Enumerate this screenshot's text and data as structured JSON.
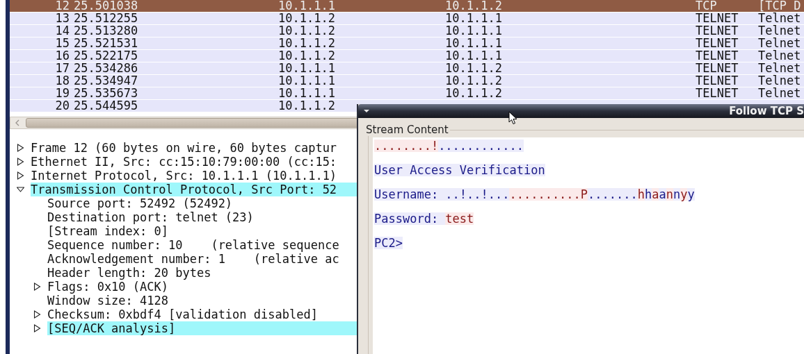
{
  "packet_list": {
    "rows": [
      {
        "no": "12",
        "time": "25.501038",
        "source": "10.1.1.1",
        "destination": "10.1.1.2",
        "protocol": "TCP",
        "info": "[TCP D",
        "selected": true
      },
      {
        "no": "13",
        "time": "25.512255",
        "source": "10.1.1.2",
        "destination": "10.1.1.1",
        "protocol": "TELNET",
        "info": "Telnet",
        "selected": false
      },
      {
        "no": "14",
        "time": "25.513280",
        "source": "10.1.1.2",
        "destination": "10.1.1.1",
        "protocol": "TELNET",
        "info": "Telnet",
        "selected": false
      },
      {
        "no": "15",
        "time": "25.521531",
        "source": "10.1.1.2",
        "destination": "10.1.1.1",
        "protocol": "TELNET",
        "info": "Telnet",
        "selected": false
      },
      {
        "no": "16",
        "time": "25.522175",
        "source": "10.1.1.2",
        "destination": "10.1.1.1",
        "protocol": "TELNET",
        "info": "Telnet",
        "selected": false
      },
      {
        "no": "17",
        "time": "25.534286",
        "source": "10.1.1.1",
        "destination": "10.1.1.2",
        "protocol": "TELNET",
        "info": "Telnet",
        "selected": false
      },
      {
        "no": "18",
        "time": "25.534947",
        "source": "10.1.1.1",
        "destination": "10.1.1.2",
        "protocol": "TELNET",
        "info": "Telnet",
        "selected": false
      },
      {
        "no": "19",
        "time": "25.535673",
        "source": "10.1.1.1",
        "destination": "10.1.1.2",
        "protocol": "TELNET",
        "info": "Telnet",
        "selected": false
      },
      {
        "no": "20",
        "time": "25.544595",
        "source": "10.1.1.2",
        "selected": false
      }
    ]
  },
  "packet_details": {
    "items": [
      {
        "label": "Frame 12 (60 bytes on wire, 60 bytes captur",
        "expanded": false,
        "highlighted": false
      },
      {
        "label": "Ethernet II, Src: cc:15:10:79:00:00 (cc:15:",
        "expanded": false,
        "highlighted": false
      },
      {
        "label": "Internet Protocol, Src: 10.1.1.1 (10.1.1.1)",
        "expanded": false,
        "highlighted": false
      },
      {
        "label": "Transmission Control Protocol, Src Port: 52",
        "expanded": true,
        "highlighted": true,
        "children": [
          {
            "label": "Source port: 52492 (52492)",
            "highlighted": false
          },
          {
            "label": "Destination port: telnet (23)",
            "highlighted": false
          },
          {
            "label": "[Stream index: 0]",
            "highlighted": false
          },
          {
            "label": "Sequence number: 10    (relative sequence",
            "highlighted": false
          },
          {
            "label": "Acknowledgement number: 1    (relative ac",
            "highlighted": false
          },
          {
            "label": "Header length: 20 bytes",
            "highlighted": false
          },
          {
            "label": "Flags: 0x10 (ACK)",
            "expanded": false,
            "highlighted": false
          },
          {
            "label": "Window size: 4128",
            "highlighted": false
          },
          {
            "label": "Checksum: 0xbdf4 [validation disabled]",
            "expanded": false,
            "highlighted": false
          },
          {
            "label": "[SEQ/ACK analysis]",
            "expanded": false,
            "highlighted": true
          }
        ]
      }
    ]
  },
  "follow_dialog": {
    "title": "Follow TCP S",
    "frame_label": "Stream Content",
    "lines": [
      {
        "segments": [
          {
            "text": "........!",
            "from_client": true
          },
          {
            "text": "............",
            "from_client": false
          }
        ]
      },
      {
        "segments": [
          {
            "text": "User Access Verification",
            "from_client": false
          }
        ]
      },
      {
        "segments": [
          {
            "text": "Username: ..!..!...",
            "from_client": false
          },
          {
            "text": "..........P",
            "from_client": true
          },
          {
            "text": ".......",
            "from_client": false
          },
          {
            "text": "h",
            "from_client": true
          },
          {
            "text": "h",
            "from_client": false
          },
          {
            "text": "a",
            "from_client": true
          },
          {
            "text": "a",
            "from_client": false
          },
          {
            "text": "n",
            "from_client": true
          },
          {
            "text": "n",
            "from_client": false
          },
          {
            "text": "y",
            "from_client": true
          },
          {
            "text": "y",
            "from_client": false
          }
        ]
      },
      {
        "segments": [
          {
            "text": "Password: ",
            "from_client": false
          },
          {
            "text": "test",
            "from_client": true
          }
        ]
      },
      {
        "segments": [
          {
            "text": "PC2>",
            "from_client": false
          }
        ]
      }
    ]
  }
}
